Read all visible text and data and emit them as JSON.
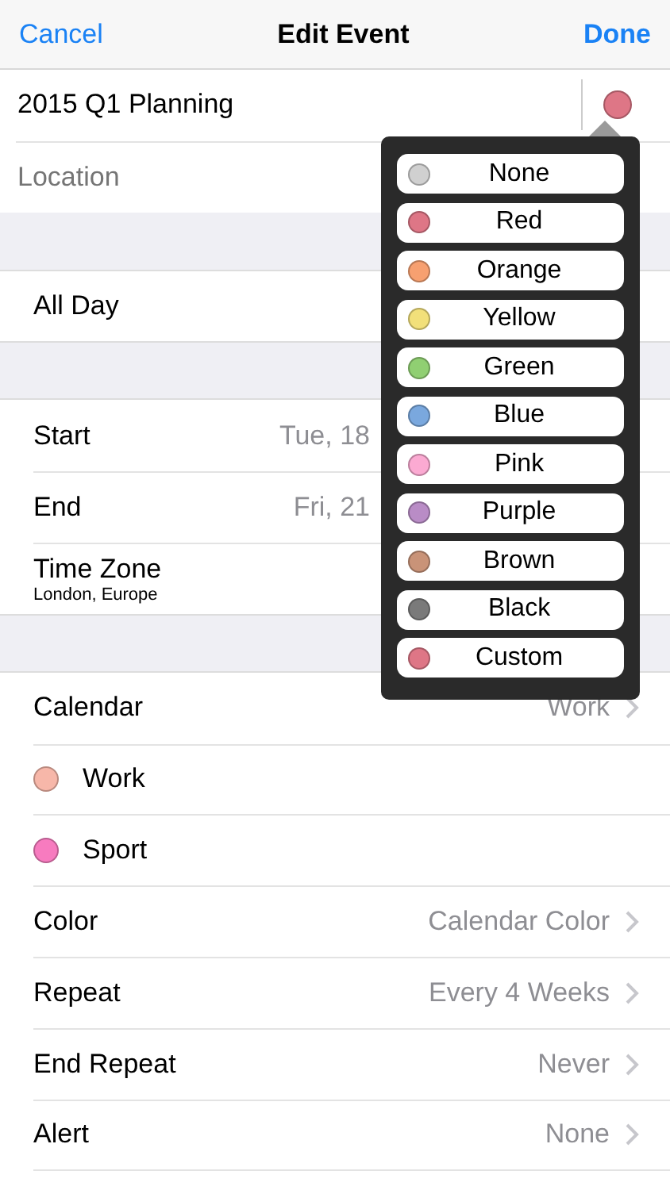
{
  "nav": {
    "cancel": "Cancel",
    "title": "Edit Event",
    "done": "Done"
  },
  "title_field": {
    "value": "2015 Q1 Planning",
    "color": "#de7686"
  },
  "location": {
    "placeholder": "Location"
  },
  "all_day": {
    "label": "All Day"
  },
  "times": [
    {
      "label": "Start",
      "value": "Tue, 18"
    },
    {
      "label": "End",
      "value": "Fri, 21"
    },
    {
      "label": "Time Zone",
      "sub": "London, Europe"
    }
  ],
  "calendar": {
    "label": "Calendar",
    "value": "Work"
  },
  "calendars": [
    {
      "name": "Work",
      "color": "#f7b7a9"
    },
    {
      "name": "Sport",
      "color": "#f77bbf"
    }
  ],
  "settings": [
    {
      "label": "Color",
      "value": "Calendar Color"
    },
    {
      "label": "Repeat",
      "value": "Every 4 Weeks"
    },
    {
      "label": "End Repeat",
      "value": "Never"
    },
    {
      "label": "Alert",
      "value": "None"
    }
  ],
  "color_menu": [
    {
      "label": "None",
      "color": "#d0d0d0"
    },
    {
      "label": "Red",
      "color": "#de7686"
    },
    {
      "label": "Orange",
      "color": "#f7a070"
    },
    {
      "label": "Yellow",
      "color": "#f2e07a"
    },
    {
      "label": "Green",
      "color": "#90cf72"
    },
    {
      "label": "Blue",
      "color": "#7aa8de"
    },
    {
      "label": "Pink",
      "color": "#fbaad2"
    },
    {
      "label": "Purple",
      "color": "#b98cc6"
    },
    {
      "label": "Brown",
      "color": "#c99378"
    },
    {
      "label": "Black",
      "color": "#7a7a7a"
    },
    {
      "label": "Custom",
      "color": "#de7686"
    }
  ]
}
